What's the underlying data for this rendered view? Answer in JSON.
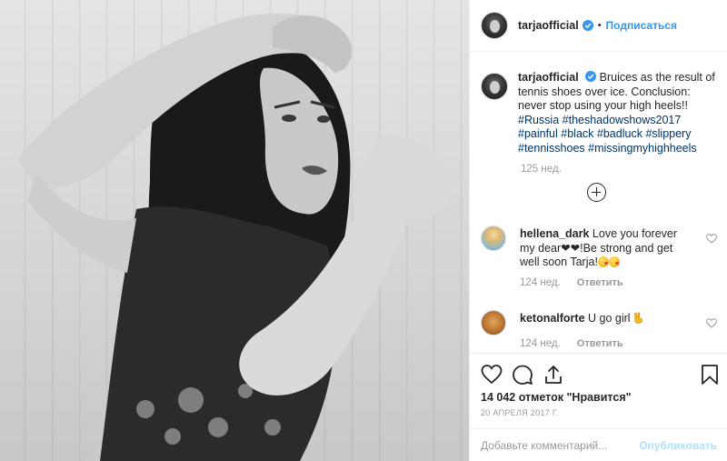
{
  "header": {
    "username": "tarjaofficial",
    "separator": "•",
    "follow_label": "Подписаться"
  },
  "caption": {
    "username": "tarjaofficial",
    "text": "Bruices as the result of tennis shoes over ice. Conclusion: never stop using your high heels!!",
    "hashtags": [
      "#Russia",
      "#theshadowshows2017",
      "#painful",
      "#black",
      "#badluck",
      "#slippery",
      "#tennisshoes",
      "#missingmyhighheels"
    ],
    "time": "125 нед."
  },
  "comments": [
    {
      "username": "hellena_dark",
      "text_1": "Love you forever my dear",
      "text_2": "!Be strong and get well soon Tarja!",
      "time": "124 нед.",
      "reply_label": "Ответить"
    },
    {
      "username": "ketonalforte",
      "text_1": "U go girl",
      "time": "124 нед.",
      "reply_label": "Ответить"
    }
  ],
  "stats": {
    "likes": "14 042 отметок \"Нравится\"",
    "date": "20 АПРЕЛЯ 2017 Г."
  },
  "add_comment": {
    "placeholder": "Добавьте комментарий...",
    "publish_label": "Опубликовать"
  },
  "colors": {
    "accent": "#3897f0",
    "hashtag": "#003569",
    "muted": "#999999",
    "publish_disabled": "#b2dffc"
  },
  "icons": [
    "verified-badge-icon",
    "plus-circle-icon",
    "heart-icon",
    "comment-icon",
    "share-icon",
    "bookmark-icon"
  ]
}
